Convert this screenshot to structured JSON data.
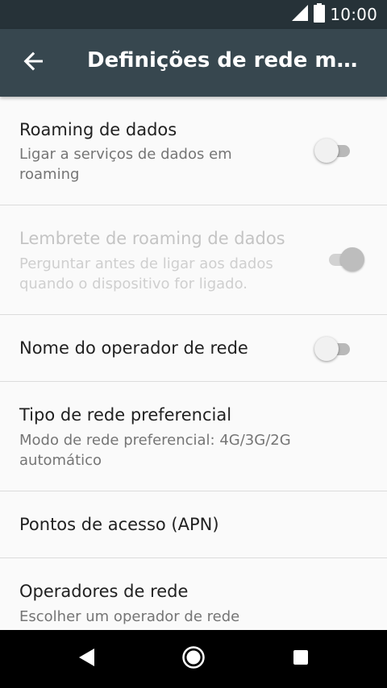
{
  "status_bar": {
    "time": "10:00",
    "icons": [
      "signal-icon",
      "battery-icon"
    ]
  },
  "app_bar": {
    "title": "Definições de rede móv…",
    "back_icon": "arrow-back-icon"
  },
  "settings": [
    {
      "title": "Roaming de dados",
      "subtitle": "Ligar a serviços de dados em roaming",
      "toggle": "off",
      "enabled": true
    },
    {
      "title": "Lembrete de roaming de dados",
      "subtitle": "Perguntar antes de ligar aos dados quando o dispositivo for ligado.",
      "toggle": "on",
      "enabled": false
    },
    {
      "title": "Nome do operador de rede",
      "toggle": "off",
      "enabled": true
    },
    {
      "title": "Tipo de rede preferencial",
      "subtitle": "Modo de rede preferencial: 4G/3G/2G automático",
      "enabled": true
    },
    {
      "title": "Pontos de acesso (APN)",
      "enabled": true
    },
    {
      "title": "Operadores de rede",
      "subtitle": "Escolher um operador de rede",
      "enabled": true
    }
  ],
  "nav_bar": {
    "icons": [
      "back-triangle-icon",
      "home-circle-icon",
      "recents-square-icon"
    ]
  },
  "colors": {
    "status_bar": "#263238",
    "app_bar": "#37474f",
    "background": "#fafafa",
    "nav_bar": "#000000"
  }
}
